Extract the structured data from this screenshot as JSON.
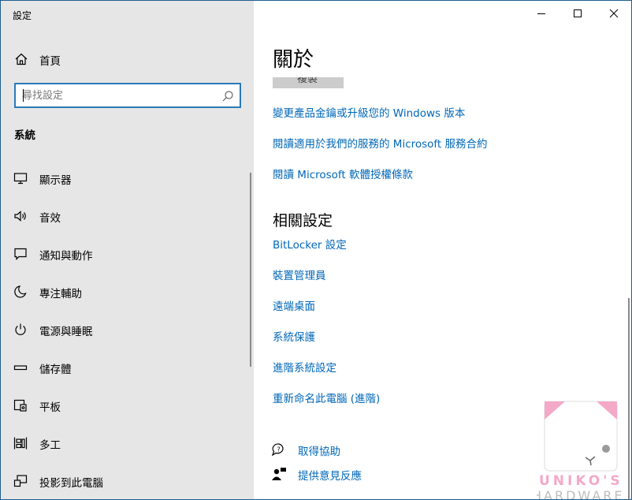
{
  "window": {
    "app_title": "設定",
    "minimize_icon": "minimize-icon",
    "maximize_icon": "maximize-icon",
    "close_icon": "close-icon"
  },
  "sidebar": {
    "home_label": "首頁",
    "search_placeholder": "尋找設定",
    "section_label": "系統",
    "items": [
      {
        "label": "顯示器",
        "icon": "monitor-icon"
      },
      {
        "label": "音效",
        "icon": "speaker-icon"
      },
      {
        "label": "通知與動作",
        "icon": "notification-icon"
      },
      {
        "label": "專注輔助",
        "icon": "moon-icon"
      },
      {
        "label": "電源與睡眠",
        "icon": "power-icon"
      },
      {
        "label": "儲存體",
        "icon": "storage-icon"
      },
      {
        "label": "平板",
        "icon": "tablet-icon"
      },
      {
        "label": "多工",
        "icon": "multitask-icon"
      },
      {
        "label": "投影到此電腦",
        "icon": "project-icon"
      }
    ]
  },
  "main": {
    "title": "關於",
    "partial_button_label": "複製",
    "links_top": [
      "變更產品金鑰或升級您的 Windows 版本",
      "閱讀適用於我們的服務的 Microsoft 服務合約",
      "閱讀 Microsoft 軟體授權條款"
    ],
    "related_heading": "相關設定",
    "related_links": [
      "BitLocker 設定",
      "裝置管理員",
      "遠端桌面",
      "系統保護",
      "進階系統設定",
      "重新命名此電腦 (進階)"
    ],
    "help": [
      {
        "label": "取得協助",
        "icon": "help-chat-icon"
      },
      {
        "label": "提供意見反應",
        "icon": "feedback-icon"
      }
    ]
  },
  "watermark": {
    "line1": "UNIKO'S",
    "line2": "HARDWARE"
  },
  "colors": {
    "link": "#0067b8",
    "sidebar_bg": "#e6e6e6",
    "search_border": "#2b7ab8",
    "watermark_pink": "#f4a9c8"
  }
}
